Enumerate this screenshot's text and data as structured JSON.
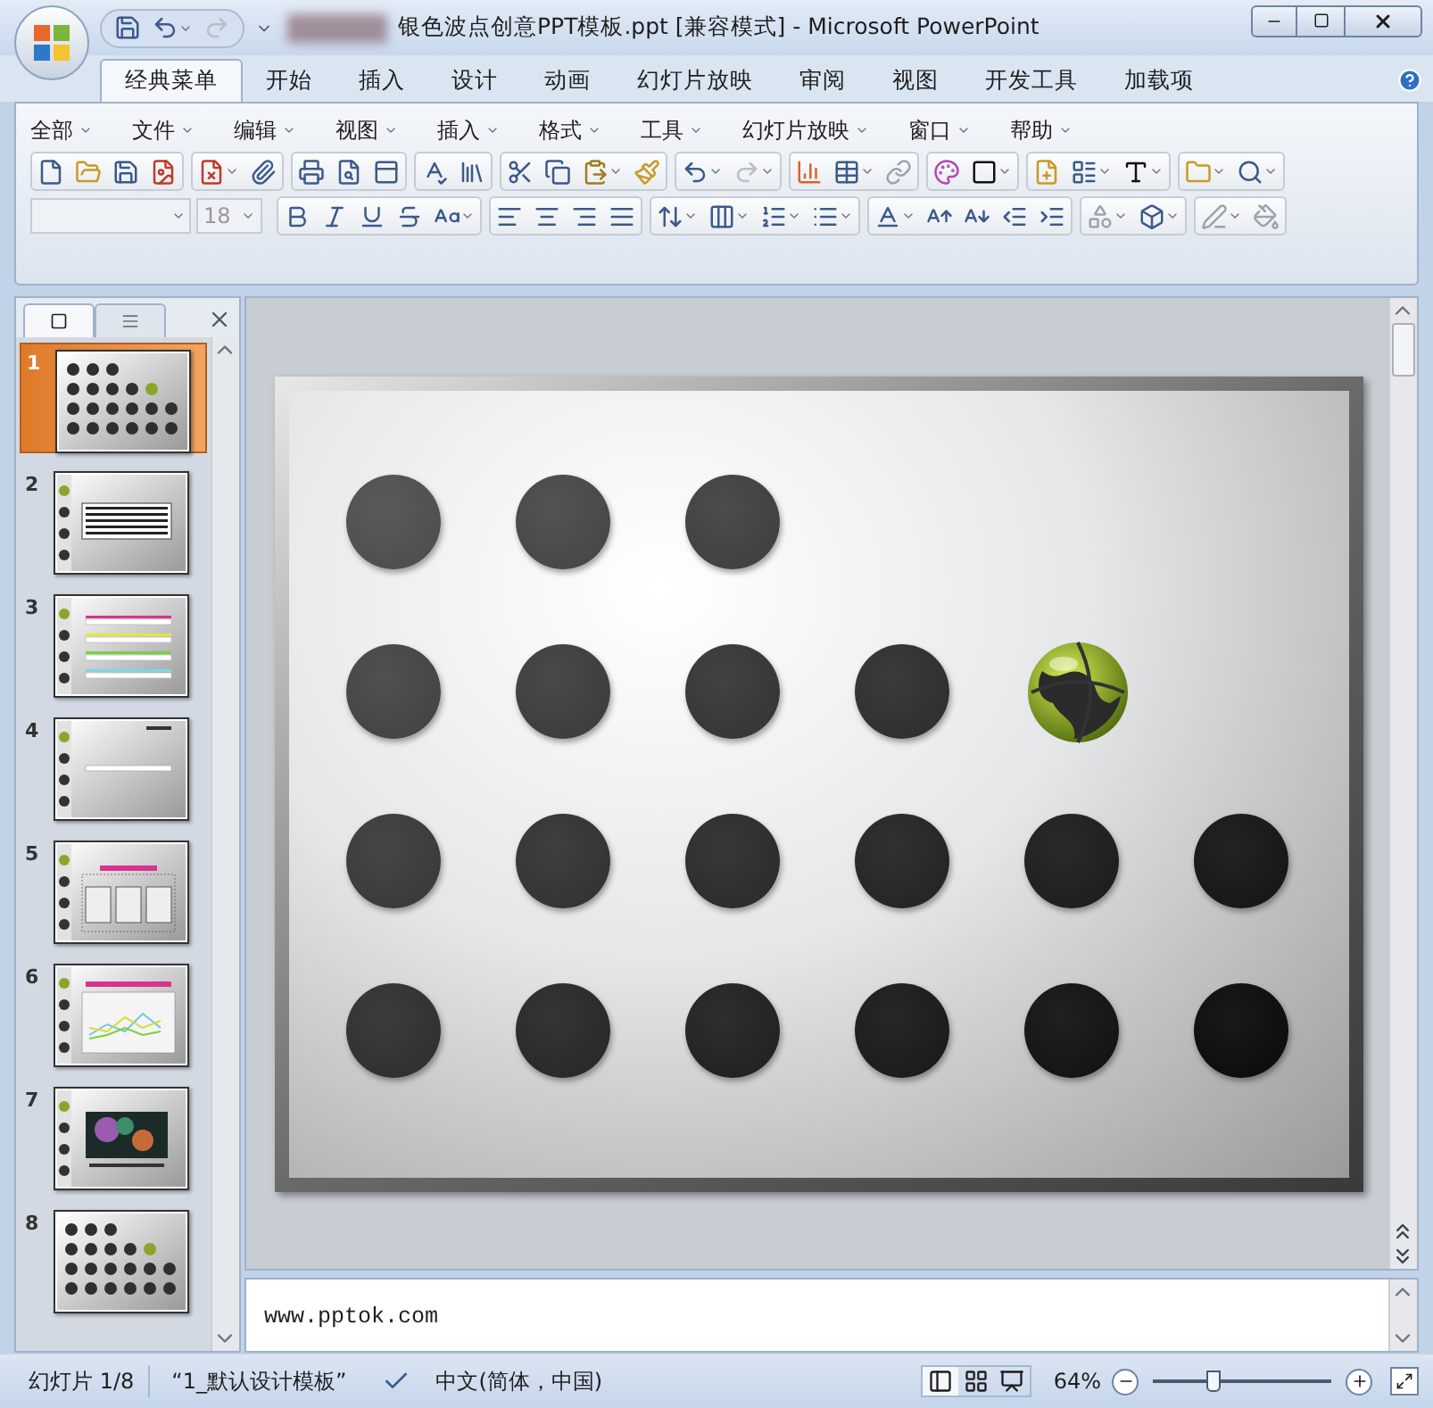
{
  "window": {
    "title": "银色波点创意PPT模板.ppt [兼容模式] - Microsoft PowerPoint"
  },
  "quick_access": {
    "redo": {
      "disabled": true
    }
  },
  "ribbon_tabs": [
    {
      "label": "经典菜单",
      "selected": true
    },
    {
      "label": "开始",
      "selected": false
    },
    {
      "label": "插入",
      "selected": false
    },
    {
      "label": "设计",
      "selected": false
    },
    {
      "label": "动画",
      "selected": false
    },
    {
      "label": "幻灯片放映",
      "selected": false
    },
    {
      "label": "审阅",
      "selected": false
    },
    {
      "label": "视图",
      "selected": false
    },
    {
      "label": "开发工具",
      "selected": false
    },
    {
      "label": "加载项",
      "selected": false
    }
  ],
  "menu_bar": [
    "全部",
    "文件",
    "编辑",
    "视图",
    "插入",
    "格式",
    "工具",
    "幻灯片放映",
    "窗口",
    "帮助"
  ],
  "format_toolbar": {
    "font_size": "18"
  },
  "slides_panel": {
    "slides": [
      {
        "number": "1",
        "kind": "dots",
        "selected": true
      },
      {
        "number": "2",
        "kind": "text",
        "selected": false
      },
      {
        "number": "3",
        "kind": "lines",
        "selected": false
      },
      {
        "number": "4",
        "kind": "title",
        "selected": false
      },
      {
        "number": "5",
        "kind": "table",
        "selected": false
      },
      {
        "number": "6",
        "kind": "chart",
        "selected": false
      },
      {
        "number": "7",
        "kind": "photo",
        "selected": false
      },
      {
        "number": "8",
        "kind": "dots",
        "selected": false
      }
    ]
  },
  "notes": "www.pptok.com",
  "status_bar": {
    "slide": "幻灯片 1/8",
    "theme": "“1_默认设计模板”",
    "language": "中文(简体，中国)",
    "zoom": "64%",
    "zoom_slider": {
      "level": 0.34
    }
  }
}
